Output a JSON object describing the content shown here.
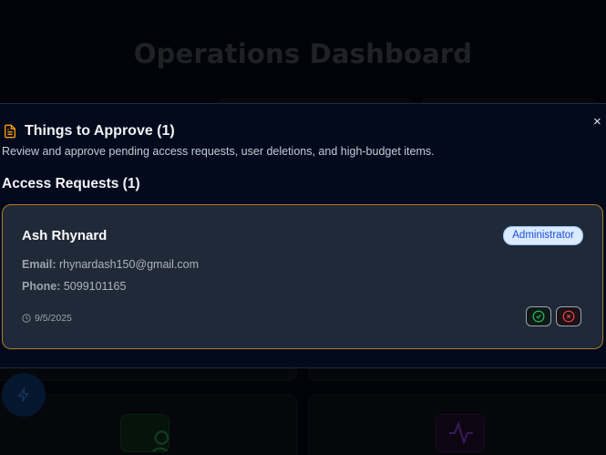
{
  "background": {
    "title": "Operations Dashboard"
  },
  "modal": {
    "title": "Things to Approve (1)",
    "description": "Review and approve pending access requests, user deletions, and high-budget items.",
    "close_label": "×",
    "section_title": "Access Requests (1)",
    "requests": [
      {
        "name": "Ash Rhynard",
        "role": "Administrator",
        "email_label": "Email:",
        "email": "rhynardash150@gmail.com",
        "phone_label": "Phone:",
        "phone": "5099101165",
        "date": "9/5/2025"
      }
    ]
  },
  "icons": {
    "modal_header": "document-icon",
    "date": "clock-icon",
    "approve": "check-circle-icon",
    "reject": "x-circle-icon",
    "fab": "bolt-icon"
  },
  "colors": {
    "accent_orange": "#f59e0b",
    "approve_green": "#22c55e",
    "reject_red": "#ef4444",
    "badge_blue": "#1d4ed8"
  }
}
